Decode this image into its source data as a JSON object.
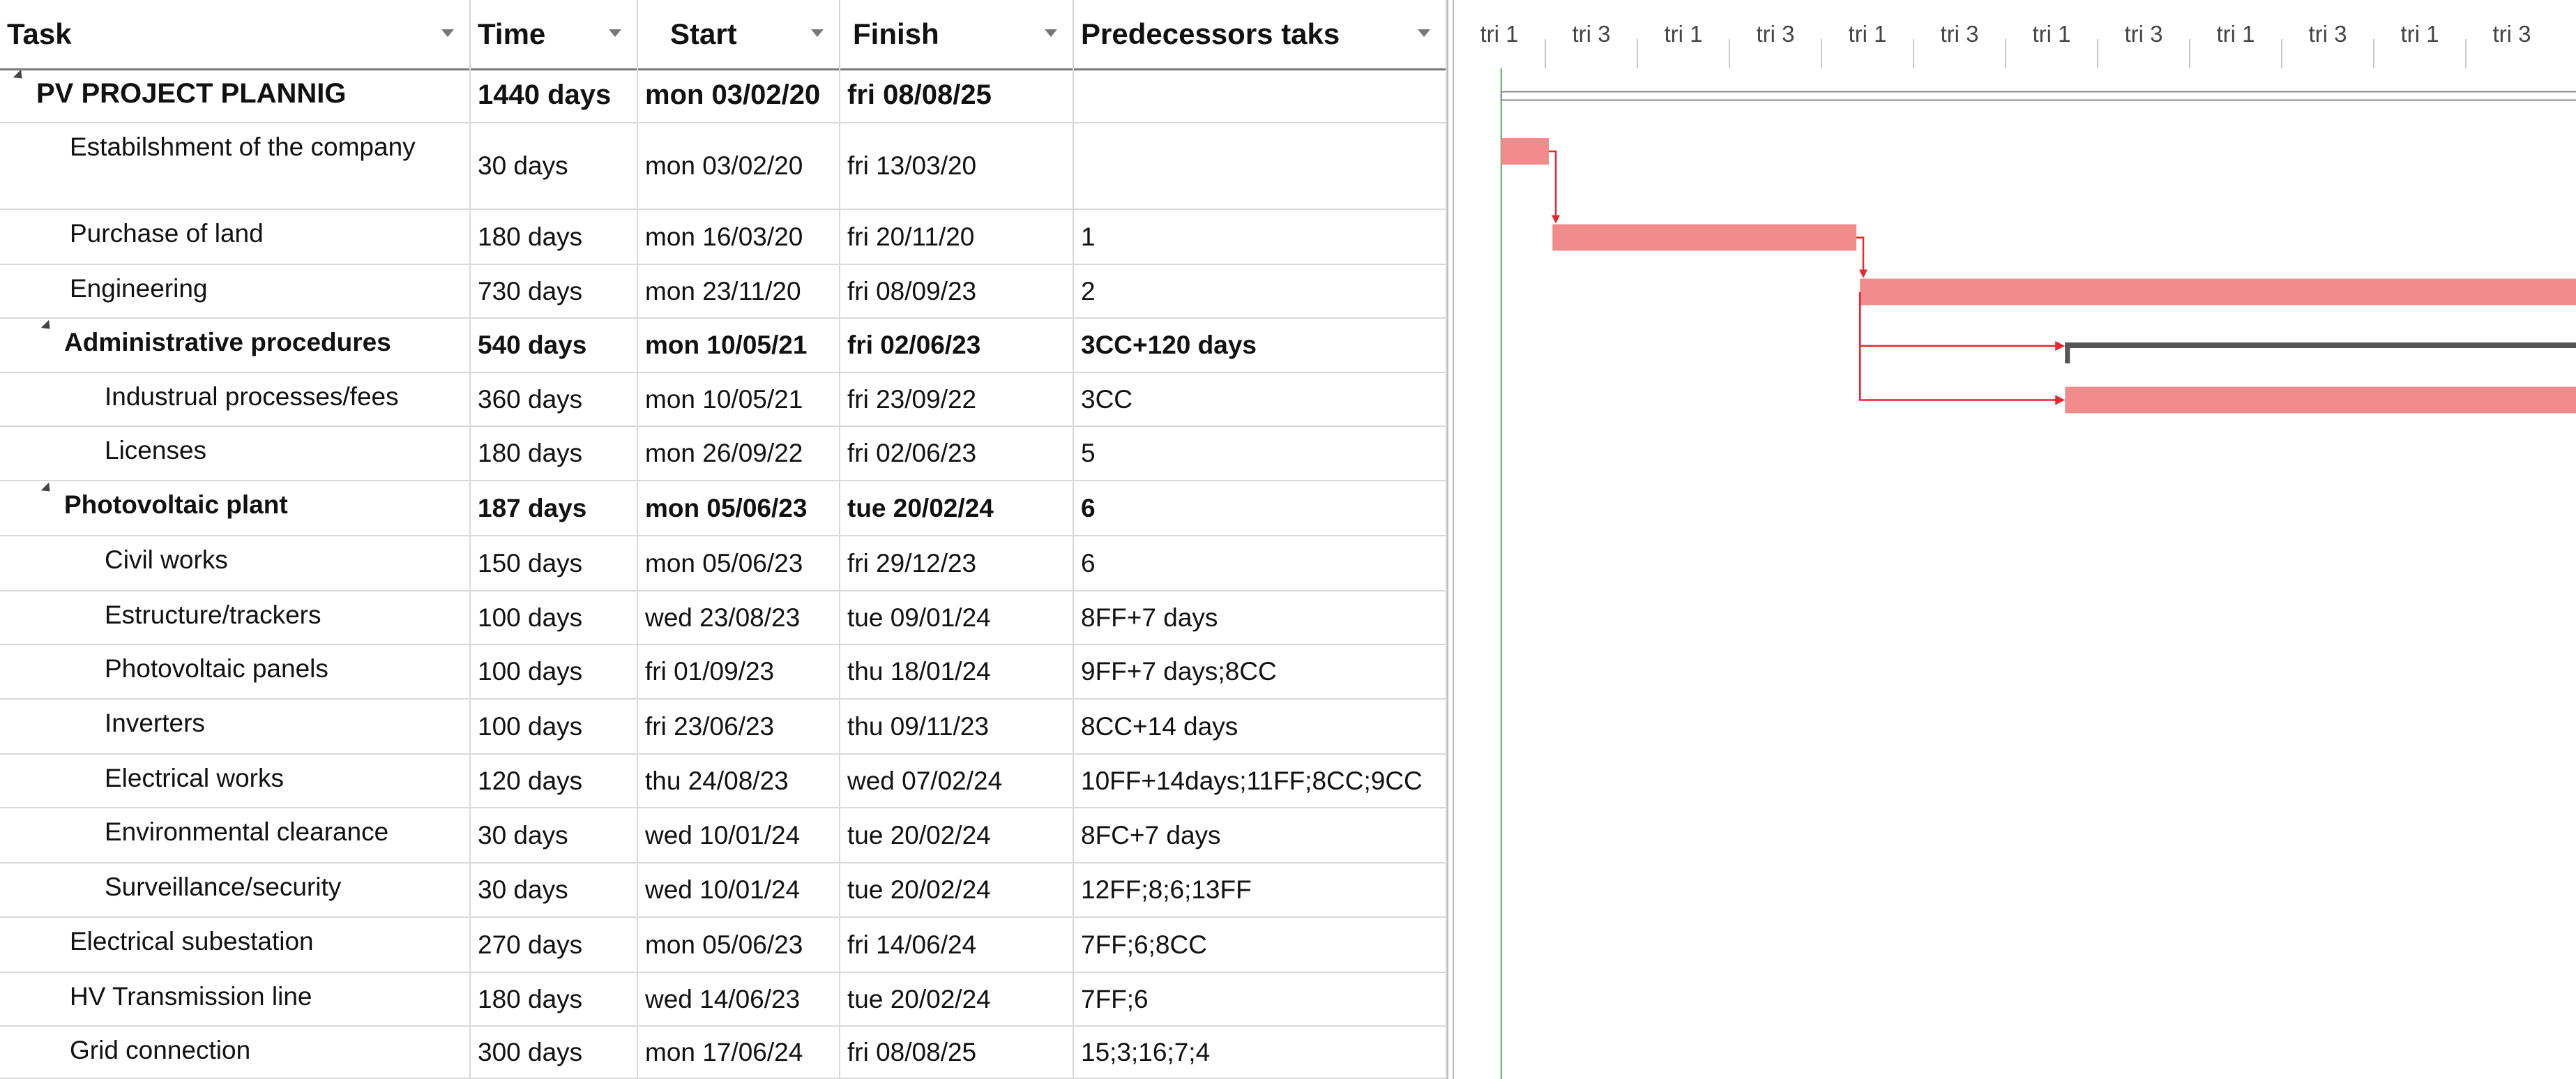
{
  "columns": {
    "task": "Task",
    "time": "Time",
    "start": "Start",
    "finish": "Finish",
    "predecessors": "Predecessors taks"
  },
  "rows": [
    {
      "name": "PV PROJECT PLANNIG",
      "time": "1440  days",
      "start": "mon 03/02/20",
      "finish": "fri 08/08/25",
      "pred": "",
      "level": 0,
      "summary": true
    },
    {
      "name": "Estabilshment of the company",
      "time": "30  days",
      "start": "mon 03/02/20",
      "finish": "fri  13/03/20",
      "pred": "",
      "level": 1,
      "summary": false
    },
    {
      "name": "Purchase of land",
      "time": "180  days",
      "start": "mon 16/03/20",
      "finish": "fri  20/11/20",
      "pred": "1",
      "level": 1,
      "summary": false
    },
    {
      "name": "Engineering",
      "time": "730  days",
      "start": "mon 23/11/20",
      "finish": "fri  08/09/23",
      "pred": "2",
      "level": 1,
      "summary": false
    },
    {
      "name": "Administrative procedures",
      "time": "540  days",
      "start": "mon 10/05/21",
      "finish": "fri 02/06/23",
      "pred": "3CC+120 days",
      "level": 1,
      "summary": true
    },
    {
      "name": "Industrual processes/fees",
      "time": "360  days",
      "start": "mon 10/05/21",
      "finish": "fri  23/09/22",
      "pred": "3CC",
      "level": 2,
      "summary": false
    },
    {
      "name": "Licenses",
      "time": "180  days",
      "start": "mon 26/09/22",
      "finish": "fri  02/06/23",
      "pred": "5",
      "level": 2,
      "summary": false
    },
    {
      "name": "Photovoltaic plant",
      "time": "187  days",
      "start": "mon 05/06/23",
      "finish": "tue 20/02/24",
      "pred": "6",
      "level": 1,
      "summary": true
    },
    {
      "name": "Civil works",
      "time": "150  days",
      "start": "mon 05/06/23",
      "finish": "fri  29/12/23",
      "pred": "6",
      "level": 2,
      "summary": false
    },
    {
      "name": "Estructure/trackers",
      "time": "100  days",
      "start": "wed 23/08/23",
      "finish": "tue  09/01/24",
      "pred": "8FF+7 days",
      "level": 2,
      "summary": false
    },
    {
      "name": "Photovoltaic panels",
      "time": "100  days",
      "start": "fri  01/09/23",
      "finish": "thu 18/01/24",
      "pred": "9FF+7 days;8CC",
      "level": 2,
      "summary": false
    },
    {
      "name": "Inverters",
      "time": "100  days",
      "start": "fri  23/06/23",
      "finish": "thu 09/11/23",
      "pred": "8CC+14 days",
      "level": 2,
      "summary": false
    },
    {
      "name": "Electrical works",
      "time": "120  days",
      "start": "thu 24/08/23",
      "finish": "wed 07/02/24",
      "pred": "10FF+14days;11FF;8CC;9CC",
      "level": 2,
      "summary": false
    },
    {
      "name": "Environmental clearance",
      "time": "30  days",
      "start": "wed 10/01/24",
      "finish": "tue  20/02/24",
      "pred": "8FC+7 days",
      "level": 2,
      "summary": false
    },
    {
      "name": "Surveillance/security",
      "time": "30  days",
      "start": "wed 10/01/24",
      "finish": "tue  20/02/24",
      "pred": "12FF;8;6;13FF",
      "level": 2,
      "summary": false
    },
    {
      "name": "Electrical subestation",
      "time": "270  days",
      "start": "mon 05/06/23",
      "finish": "fri  14/06/24",
      "pred": "7FF;6;8CC",
      "level": 1,
      "summary": false
    },
    {
      "name": "HV Transmission line",
      "time": "180  days",
      "start": "wed 14/06/23",
      "finish": "tue  20/02/24",
      "pred": "7FF;6",
      "level": 1,
      "summary": false
    },
    {
      "name": "Grid connection",
      "time": "300  days",
      "start": "mon 17/06/24",
      "finish": "fri  08/08/25",
      "pred": "15;3;16;7;4",
      "level": 1,
      "summary": false
    }
  ],
  "timescale": [
    "tri 1",
    "tri 3",
    "tri 1",
    "tri 3",
    "tri 1",
    "tri 3",
    "tri 1",
    "tri 3",
    "tri 1",
    "tri 3",
    "tri 1",
    "tri 3"
  ],
  "colors": {
    "task_bar": "#f28b8b",
    "critical_link": "#e8262b",
    "blue_bar": "#6cb4e6",
    "blue_link": "#1f7cd0",
    "summary_bar": "#555555",
    "black_link": "#111111",
    "today_line": "#4caf50"
  }
}
